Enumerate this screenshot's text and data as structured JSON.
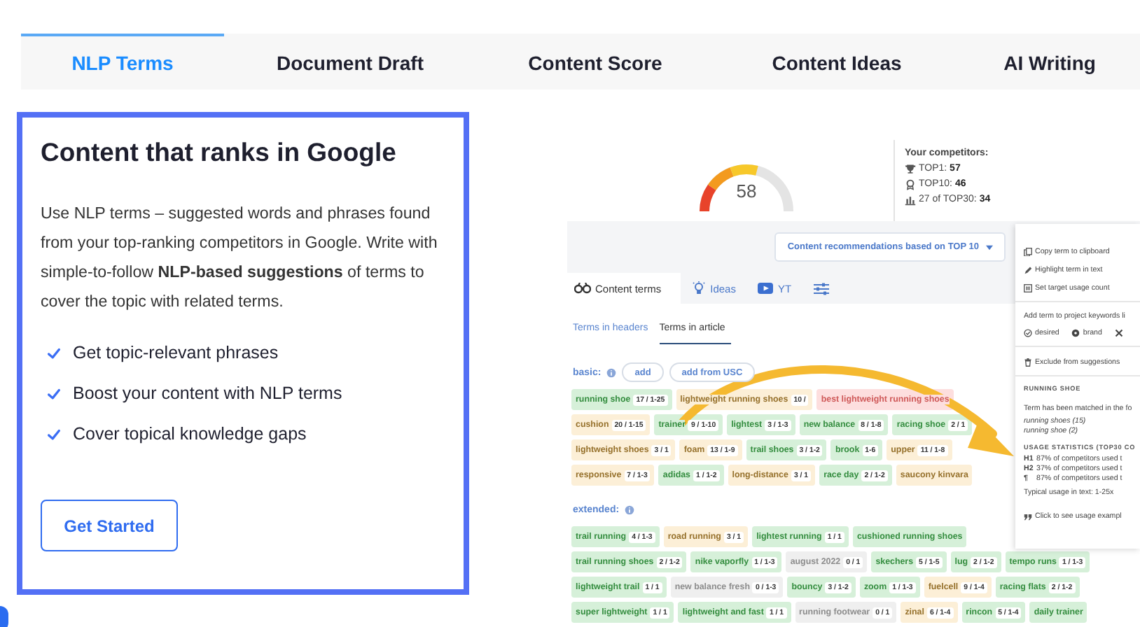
{
  "tabs": [
    {
      "label": "NLP Terms",
      "selected": true
    },
    {
      "label": "Document Draft",
      "selected": false
    },
    {
      "label": "Content Score",
      "selected": false
    },
    {
      "label": "Content Ideas",
      "selected": false
    },
    {
      "label": "AI Writing",
      "selected": false
    }
  ],
  "card": {
    "title": "Content that ranks in Google",
    "body": "Use NLP terms – suggested words and phrases found from your top-ranking competitors in Google. Write with simple-to-follow **NLP-based suggestions** of terms to cover the topic with related terms.",
    "features": [
      "Get topic-relevant phrases",
      "Boost your content with NLP terms",
      "Cover topical knowledge gaps"
    ],
    "button": "Get Started"
  },
  "preview": {
    "score": "58",
    "level": 0.58,
    "competitors": {
      "title": "Your competitors:",
      "lines": [
        {
          "kind": "trophy",
          "text": "TOP1: **57**"
        },
        {
          "kind": "medal",
          "text": "TOP10: **46**"
        },
        {
          "kind": "bars",
          "text": "27 of TOP30: **34**"
        }
      ]
    },
    "dropdown": "Content recommendations based on TOP 10",
    "tabs": [
      {
        "kind": "terms",
        "label": "Content terms",
        "selected": true
      },
      {
        "kind": "ideas",
        "label": "Ideas",
        "selected": false
      },
      {
        "kind": "video",
        "label": "YT",
        "selected": false
      },
      {
        "kind": "filters",
        "selected": false
      }
    ],
    "subtabs": [
      {
        "label": "Terms in headers",
        "selected": false
      },
      {
        "label": "Terms in article",
        "selected": true
      }
    ],
    "basic_label": "basic:",
    "basic_buttons": [
      "add",
      "add from USC"
    ],
    "basic_rows": [
      [
        {
          "term": "running shoe",
          "count": "17 / 1-25",
          "color": "#d6f0d9"
        },
        {
          "term": "lightweight running **shoes**",
          "count": "10 /",
          "color": "#fcefd7"
        },
        {
          "term": "best lightweight running **shoes**",
          "color": "#fddede"
        }
      ],
      [
        {
          "term": "cushion",
          "count": "20 / 1-15",
          "color": "#fcefd7"
        },
        {
          "term": "trainer",
          "count": "9 / 1-10",
          "color": "#d6f0d9"
        },
        {
          "term": "lightest",
          "count": "3 / 1-3",
          "color": "#d6f0d9"
        },
        {
          "term": "new balance",
          "count": "8 / 1-8",
          "color": "#d6f0d9"
        },
        {
          "term": "racing shoe",
          "count": "2 / 1",
          "color": "#d6f0d9"
        }
      ],
      [
        {
          "term": "lightweight **shoes**",
          "count": "3 / 1",
          "color": "#fcefd7"
        },
        {
          "term": "foam",
          "count": "13 / 1-9",
          "color": "#fcefd7"
        },
        {
          "term": "trail **shoes**",
          "count": "3 / 1-2",
          "color": "#d6f0d9"
        },
        {
          "term": "brook",
          "count": "1-6",
          "color": "#d6f0d9"
        },
        {
          "term": "upper",
          "count": "11 / 1-8",
          "color": "#fcefd7"
        }
      ],
      [
        {
          "term": "responsive",
          "count": "7 / 1-3",
          "color": "#fcefd7"
        },
        {
          "term": "adidas",
          "count": "1 / 1-2",
          "color": "#d6f0d9"
        },
        {
          "term": "long-distance",
          "count": "3 / 1",
          "color": "#fcefd7"
        },
        {
          "term": "race day",
          "count": "2 / 1-2",
          "color": "#d6f0d9"
        },
        {
          "term": "saucony kinvara",
          "color": "#fcefd7"
        }
      ]
    ],
    "extended_label": "extended:",
    "extended_rows": [
      [
        {
          "term": "trail running",
          "count": "4 / 1-3",
          "color": "#d6f0d9"
        },
        {
          "term": "road running",
          "count": "3 / 1",
          "color": "#fcefd7"
        },
        {
          "term": "lightest running",
          "count": "1 / 1",
          "color": "#d6f0d9"
        },
        {
          "term": "cushioned running **shoes**",
          "color": "#d6f0d9"
        }
      ],
      [
        {
          "term": "trail running **shoes**",
          "count": "2 / 1-2",
          "color": "#d6f0d9"
        },
        {
          "term": "nike vaporfly",
          "count": "1 / 1-3",
          "color": "#d6f0d9"
        },
        {
          "term": "august 2022",
          "count": "0 / 1",
          "color": "#efefef"
        },
        {
          "term": "skechers",
          "count": "5 / 1-5",
          "color": "#d6f0d9"
        },
        {
          "term": "lug",
          "count": "2 / 1-2",
          "color": "#d6f0d9"
        },
        {
          "term": "tempo runs",
          "count": "1 / 1-3",
          "color": "#d6f0d9"
        }
      ],
      [
        {
          "term": "lightweight trail",
          "count": "1 / 1",
          "color": "#d6f0d9"
        },
        {
          "term": "new balance fresh",
          "count": "0 / 1-3",
          "color": "#efefef"
        },
        {
          "term": "bouncy",
          "count": "3 / 1-2",
          "color": "#d6f0d9"
        },
        {
          "term": "zoom",
          "count": "1 / 1-3",
          "color": "#d6f0d9"
        },
        {
          "term": "fuelcell",
          "count": "9 / 1-4",
          "color": "#fcefd7"
        },
        {
          "term": "racing flats",
          "count": "2 / 1-2",
          "color": "#d6f0d9"
        }
      ],
      [
        {
          "term": "super lightweight",
          "count": "1 / 1",
          "color": "#d6f0d9"
        },
        {
          "term": "lightweight and fast",
          "count": "1 / 1",
          "color": "#d6f0d9"
        },
        {
          "term": "running footwear",
          "count": "0 / 1",
          "color": "#efefef"
        },
        {
          "term": "zinal",
          "count": "6 / 1-4",
          "color": "#fcefd7"
        },
        {
          "term": "rincon",
          "count": "5 / 1-4",
          "color": "#d6f0d9"
        },
        {
          "term": "daily trainer",
          "color": "#d6f0d9"
        }
      ]
    ],
    "menu": {
      "actions": [
        {
          "kind": "copy",
          "label": "Copy term to clipboard"
        },
        {
          "kind": "highlight",
          "label": "Highlight term in text"
        },
        {
          "kind": "target",
          "label": "Set target usage count"
        }
      ],
      "keywords_label": "Add term to project keywords li",
      "keyword_options": [
        {
          "kind": "desired",
          "label": "desired"
        },
        {
          "kind": "brand",
          "label": "brand"
        },
        {
          "kind": "cross"
        }
      ],
      "exclude": "Exclude from suggestions",
      "term_heading": "RUNNING SHOE",
      "match_note": "Term has been matched in the fo",
      "matches": [
        "running shoes (15)",
        "running shoe (2)"
      ],
      "stats_heading": "USAGE STATISTICS (TOP30 CO",
      "stats": [
        {
          "mark": "H1",
          "text": "87% of competitors used t"
        },
        {
          "mark": "H2",
          "text": "37% of competitors used t"
        },
        {
          "mark": "¶",
          "text": "87% of competitors used t"
        }
      ],
      "typical": "Typical usage in text: 1-25x",
      "example": "Click to see usage exampl"
    }
  }
}
